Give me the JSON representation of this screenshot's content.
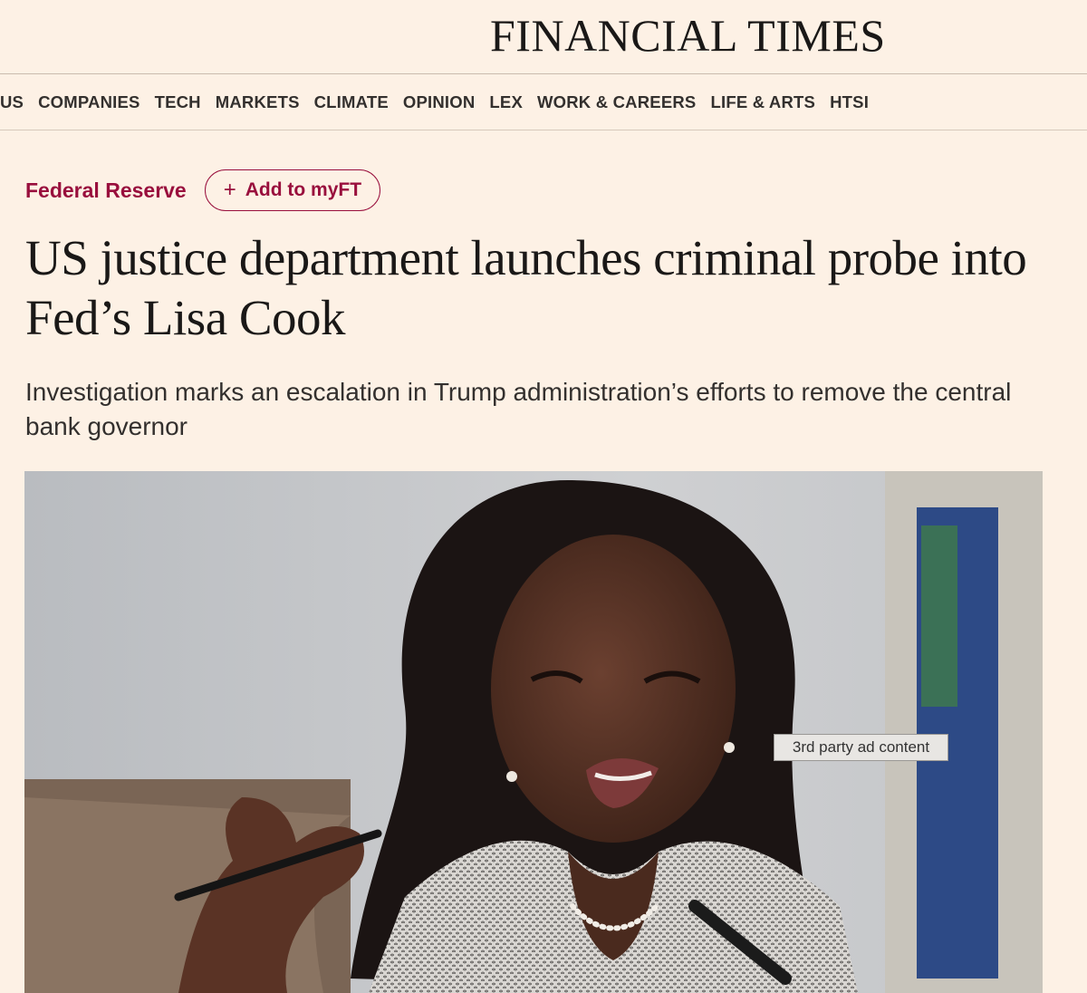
{
  "masthead": {
    "title": "FINANCIAL TIMES"
  },
  "nav": {
    "items": [
      "US",
      "COMPANIES",
      "TECH",
      "MARKETS",
      "CLIMATE",
      "OPINION",
      "LEX",
      "WORK & CAREERS",
      "LIFE & ARTS",
      "HTSI"
    ]
  },
  "article": {
    "topic": "Federal Reserve",
    "add_to_myft": "Add to myFT",
    "plus_icon": "+",
    "headline": "US justice department launches criminal probe into Fed’s Lisa Cook",
    "standfirst": "Investigation marks an escalation in Trump administration’s efforts to remove the central bank governor"
  },
  "ad": {
    "label": "3rd party ad content"
  },
  "colors": {
    "background": "#fdf1e5",
    "accent": "#990f3d",
    "text": "#1a1817"
  }
}
